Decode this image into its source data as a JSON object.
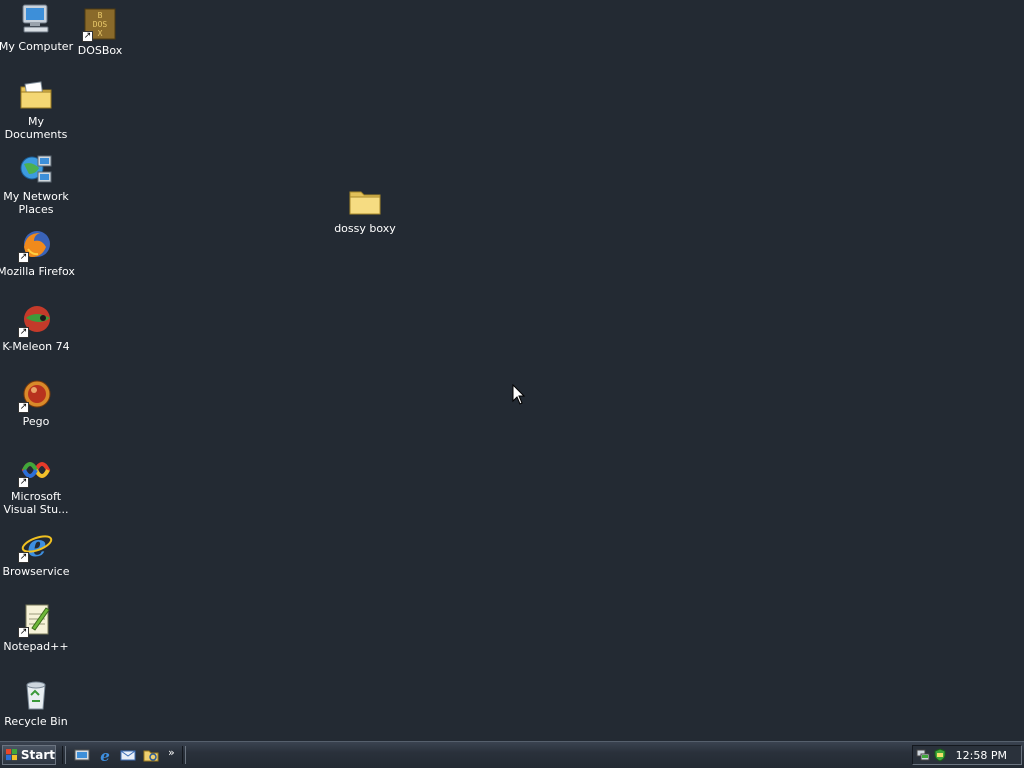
{
  "desktop": {
    "background_color": "#232a33",
    "icons": [
      {
        "label": "My Computer",
        "icon": "computer-icon"
      },
      {
        "label": "DOSBox",
        "icon": "dosbox-icon",
        "shortcut": true
      },
      {
        "label": "My Documents",
        "icon": "documents-folder-icon"
      },
      {
        "label": "My Network Places",
        "icon": "network-places-icon"
      },
      {
        "label": "Mozilla Firefox",
        "icon": "firefox-icon",
        "shortcut": true
      },
      {
        "label": "K-Meleon 74",
        "icon": "kmeleon-icon",
        "shortcut": true
      },
      {
        "label": "Pego",
        "icon": "pego-icon",
        "shortcut": true
      },
      {
        "label": "Microsoft Visual Stu...",
        "icon": "visual-studio-icon",
        "shortcut": true
      },
      {
        "label": "Browservice",
        "icon": "internet-explorer-icon",
        "shortcut": true
      },
      {
        "label": "Notepad++",
        "icon": "notepadpp-icon",
        "shortcut": true
      },
      {
        "label": "Recycle Bin",
        "icon": "recycle-bin-icon"
      },
      {
        "label": "dossy boxy",
        "icon": "folder-icon"
      }
    ]
  },
  "taskbar": {
    "start_label": "Start",
    "quick_launch": [
      "show-desktop-icon",
      "internet-explorer-icon",
      "outlook-express-icon",
      "windows-explorer-icon"
    ],
    "quick_launch_more": "»",
    "tray_icons": [
      "network-icon",
      "shield-icon"
    ],
    "clock": "12:58 PM"
  }
}
